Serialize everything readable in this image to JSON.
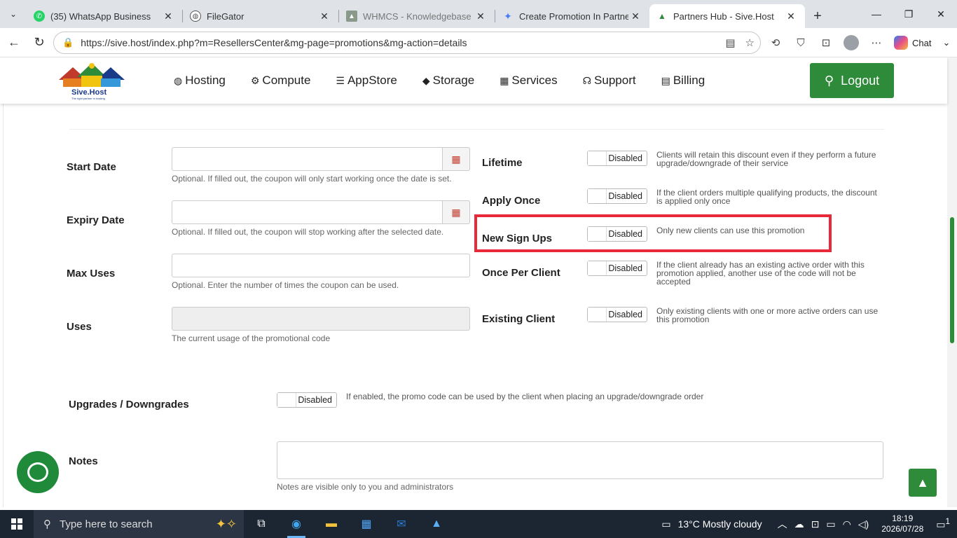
{
  "browser": {
    "tabs": [
      {
        "label": "(35) WhatsApp Business",
        "icon": "whatsapp-icon",
        "color": "#25d366"
      },
      {
        "label": "FileGator",
        "icon": "globe-icon",
        "color": "#555555"
      },
      {
        "label": "WHMCS - Knowledgebase",
        "icon": "whmcs-icon",
        "color": "#8a9a8a"
      },
      {
        "label": "Create Promotion In Partners H",
        "icon": "gemini-icon",
        "color": "#4a7cf7"
      },
      {
        "label": "Partners Hub - Sive.Host",
        "icon": "sivehost-icon",
        "color": "#2e8b3a"
      }
    ],
    "url": "https://sive.host/index.php?m=ResellersCenter&mg-page=promotions&mg-action=details",
    "chat_label": "Chat"
  },
  "site": {
    "logo_text": "Sive.Host",
    "logo_tagline": "The right partner in hosting",
    "nav": [
      {
        "label": "Hosting",
        "icon": "globe-icon"
      },
      {
        "label": "Compute",
        "icon": "gear-icon"
      },
      {
        "label": "AppStore",
        "icon": "database-icon"
      },
      {
        "label": "Storage",
        "icon": "cube-icon"
      },
      {
        "label": "Services",
        "icon": "gift-icon"
      },
      {
        "label": "Support",
        "icon": "headset-icon"
      },
      {
        "label": "Billing",
        "icon": "document-icon"
      }
    ],
    "logout_label": "Logout",
    "accent_color": "#2e8b3a"
  },
  "form": {
    "start_date": {
      "label": "Start Date",
      "value": "",
      "help": "Optional. If filled out, the coupon will only start working once the date is set."
    },
    "expiry_date": {
      "label": "Expiry Date",
      "value": "",
      "help": "Optional. If filled out, the coupon will stop working after the selected date."
    },
    "max_uses": {
      "label": "Max Uses",
      "value": "",
      "help": "Optional. Enter the number of times the coupon can be used."
    },
    "uses": {
      "label": "Uses",
      "value": "",
      "help": "The current usage of the promotional code"
    },
    "lifetime": {
      "label": "Lifetime",
      "toggle": "Disabled",
      "desc": "Clients will retain this discount even if they perform a future upgrade/downgrade of their service"
    },
    "apply_once": {
      "label": "Apply Once",
      "toggle": "Disabled",
      "desc": "If the client orders multiple qualifying products, the discount is applied only once"
    },
    "new_sign_ups": {
      "label": "New Sign Ups",
      "toggle": "Disabled",
      "desc": "Only new clients can use this promotion"
    },
    "once_per_client": {
      "label": "Once Per Client",
      "toggle": "Disabled",
      "desc": "If the client already has an existing active order with this promotion applied, another use of the code will not be accepted"
    },
    "existing_client": {
      "label": "Existing Client",
      "toggle": "Disabled",
      "desc": "Only existing clients with one or more active orders can use this promotion"
    },
    "upgrades": {
      "label": "Upgrades / Downgrades",
      "toggle": "Disabled",
      "desc": "If enabled, the promo code can be used by the client when placing an upgrade/downgrade order"
    },
    "notes": {
      "label": "Notes",
      "value": "",
      "help": "Notes are visible only to you and administrators"
    }
  },
  "taskbar": {
    "search_placeholder": "Type here to search",
    "weather": "13°C  Mostly cloudy",
    "time": "18:19",
    "date": "2026/07/28",
    "notification_count": "1"
  }
}
